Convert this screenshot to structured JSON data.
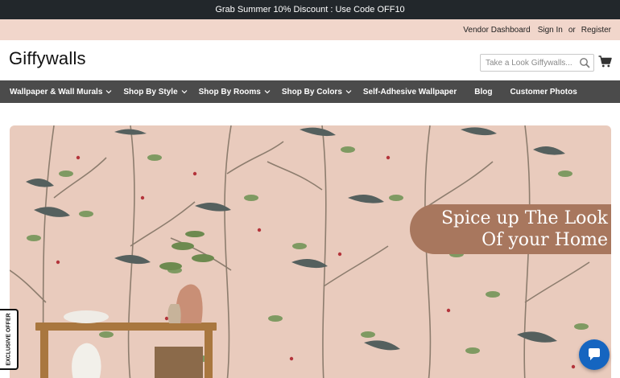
{
  "promo": {
    "text": "Grab Summer 10% Discount : Use Code OFF10"
  },
  "util": {
    "vendor": "Vendor Dashboard",
    "signin": "Sign In",
    "or": "or",
    "register": "Register"
  },
  "header": {
    "logo": "Giffywalls",
    "search_placeholder": "Take a Look Giffywalls..."
  },
  "nav": {
    "items": [
      {
        "label": "Wallpaper & Wall Murals",
        "dropdown": true
      },
      {
        "label": "Shop By Style",
        "dropdown": true
      },
      {
        "label": "Shop By Rooms",
        "dropdown": true
      },
      {
        "label": "Shop By Colors",
        "dropdown": true
      },
      {
        "label": "Self-Adhesive Wallpaper",
        "dropdown": false
      },
      {
        "label": "Blog",
        "dropdown": false
      },
      {
        "label": "Customer Photos",
        "dropdown": false
      }
    ]
  },
  "hero": {
    "line1": "Spice up The Look",
    "line2": "Of your Home"
  },
  "exclusive": {
    "label": "EXCLUSIVE OFFER"
  },
  "colors": {
    "promo_bg": "#22272b",
    "util_bg": "#f1d6cb",
    "nav_bg": "#4b4b4b",
    "badge_bg": "#a8775e",
    "chat_bg": "#1565c0"
  }
}
